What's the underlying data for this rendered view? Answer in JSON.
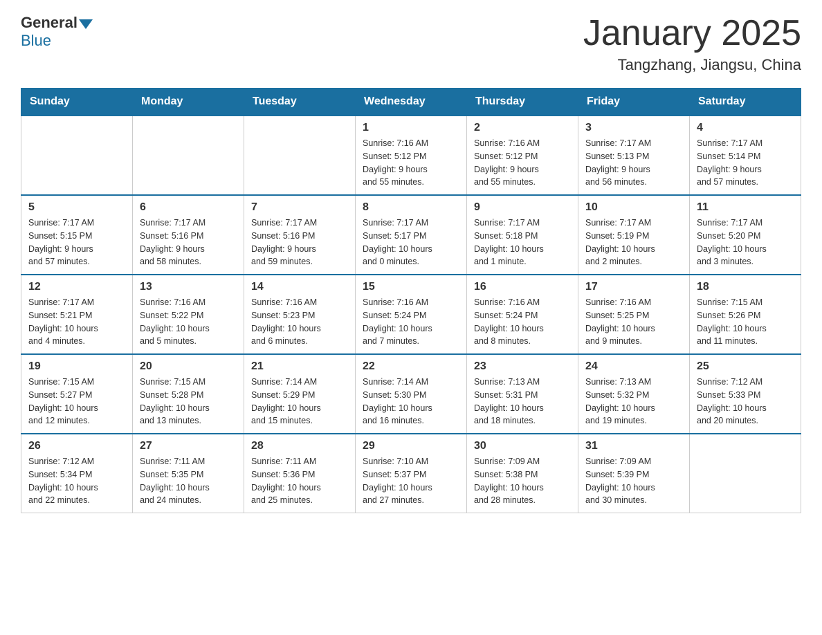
{
  "header": {
    "logo_general": "General",
    "logo_blue": "Blue",
    "month_title": "January 2025",
    "location": "Tangzhang, Jiangsu, China"
  },
  "days_of_week": [
    "Sunday",
    "Monday",
    "Tuesday",
    "Wednesday",
    "Thursday",
    "Friday",
    "Saturday"
  ],
  "weeks": [
    [
      {
        "day": "",
        "info": ""
      },
      {
        "day": "",
        "info": ""
      },
      {
        "day": "",
        "info": ""
      },
      {
        "day": "1",
        "info": "Sunrise: 7:16 AM\nSunset: 5:12 PM\nDaylight: 9 hours\nand 55 minutes."
      },
      {
        "day": "2",
        "info": "Sunrise: 7:16 AM\nSunset: 5:12 PM\nDaylight: 9 hours\nand 55 minutes."
      },
      {
        "day": "3",
        "info": "Sunrise: 7:17 AM\nSunset: 5:13 PM\nDaylight: 9 hours\nand 56 minutes."
      },
      {
        "day": "4",
        "info": "Sunrise: 7:17 AM\nSunset: 5:14 PM\nDaylight: 9 hours\nand 57 minutes."
      }
    ],
    [
      {
        "day": "5",
        "info": "Sunrise: 7:17 AM\nSunset: 5:15 PM\nDaylight: 9 hours\nand 57 minutes."
      },
      {
        "day": "6",
        "info": "Sunrise: 7:17 AM\nSunset: 5:16 PM\nDaylight: 9 hours\nand 58 minutes."
      },
      {
        "day": "7",
        "info": "Sunrise: 7:17 AM\nSunset: 5:16 PM\nDaylight: 9 hours\nand 59 minutes."
      },
      {
        "day": "8",
        "info": "Sunrise: 7:17 AM\nSunset: 5:17 PM\nDaylight: 10 hours\nand 0 minutes."
      },
      {
        "day": "9",
        "info": "Sunrise: 7:17 AM\nSunset: 5:18 PM\nDaylight: 10 hours\nand 1 minute."
      },
      {
        "day": "10",
        "info": "Sunrise: 7:17 AM\nSunset: 5:19 PM\nDaylight: 10 hours\nand 2 minutes."
      },
      {
        "day": "11",
        "info": "Sunrise: 7:17 AM\nSunset: 5:20 PM\nDaylight: 10 hours\nand 3 minutes."
      }
    ],
    [
      {
        "day": "12",
        "info": "Sunrise: 7:17 AM\nSunset: 5:21 PM\nDaylight: 10 hours\nand 4 minutes."
      },
      {
        "day": "13",
        "info": "Sunrise: 7:16 AM\nSunset: 5:22 PM\nDaylight: 10 hours\nand 5 minutes."
      },
      {
        "day": "14",
        "info": "Sunrise: 7:16 AM\nSunset: 5:23 PM\nDaylight: 10 hours\nand 6 minutes."
      },
      {
        "day": "15",
        "info": "Sunrise: 7:16 AM\nSunset: 5:24 PM\nDaylight: 10 hours\nand 7 minutes."
      },
      {
        "day": "16",
        "info": "Sunrise: 7:16 AM\nSunset: 5:24 PM\nDaylight: 10 hours\nand 8 minutes."
      },
      {
        "day": "17",
        "info": "Sunrise: 7:16 AM\nSunset: 5:25 PM\nDaylight: 10 hours\nand 9 minutes."
      },
      {
        "day": "18",
        "info": "Sunrise: 7:15 AM\nSunset: 5:26 PM\nDaylight: 10 hours\nand 11 minutes."
      }
    ],
    [
      {
        "day": "19",
        "info": "Sunrise: 7:15 AM\nSunset: 5:27 PM\nDaylight: 10 hours\nand 12 minutes."
      },
      {
        "day": "20",
        "info": "Sunrise: 7:15 AM\nSunset: 5:28 PM\nDaylight: 10 hours\nand 13 minutes."
      },
      {
        "day": "21",
        "info": "Sunrise: 7:14 AM\nSunset: 5:29 PM\nDaylight: 10 hours\nand 15 minutes."
      },
      {
        "day": "22",
        "info": "Sunrise: 7:14 AM\nSunset: 5:30 PM\nDaylight: 10 hours\nand 16 minutes."
      },
      {
        "day": "23",
        "info": "Sunrise: 7:13 AM\nSunset: 5:31 PM\nDaylight: 10 hours\nand 18 minutes."
      },
      {
        "day": "24",
        "info": "Sunrise: 7:13 AM\nSunset: 5:32 PM\nDaylight: 10 hours\nand 19 minutes."
      },
      {
        "day": "25",
        "info": "Sunrise: 7:12 AM\nSunset: 5:33 PM\nDaylight: 10 hours\nand 20 minutes."
      }
    ],
    [
      {
        "day": "26",
        "info": "Sunrise: 7:12 AM\nSunset: 5:34 PM\nDaylight: 10 hours\nand 22 minutes."
      },
      {
        "day": "27",
        "info": "Sunrise: 7:11 AM\nSunset: 5:35 PM\nDaylight: 10 hours\nand 24 minutes."
      },
      {
        "day": "28",
        "info": "Sunrise: 7:11 AM\nSunset: 5:36 PM\nDaylight: 10 hours\nand 25 minutes."
      },
      {
        "day": "29",
        "info": "Sunrise: 7:10 AM\nSunset: 5:37 PM\nDaylight: 10 hours\nand 27 minutes."
      },
      {
        "day": "30",
        "info": "Sunrise: 7:09 AM\nSunset: 5:38 PM\nDaylight: 10 hours\nand 28 minutes."
      },
      {
        "day": "31",
        "info": "Sunrise: 7:09 AM\nSunset: 5:39 PM\nDaylight: 10 hours\nand 30 minutes."
      },
      {
        "day": "",
        "info": ""
      }
    ]
  ]
}
